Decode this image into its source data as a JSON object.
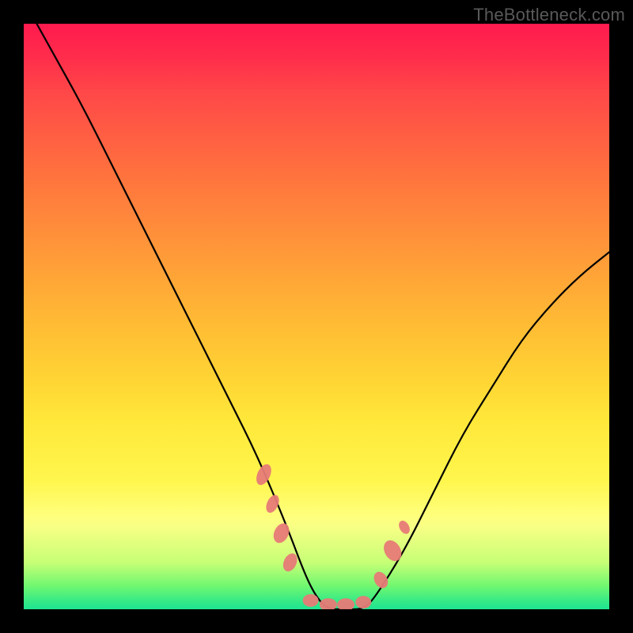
{
  "watermark": "TheBottleneck.com",
  "colors": {
    "background": "#000000",
    "curve_stroke": "#000000",
    "marker_fill": "#e77b77",
    "watermark_text": "#595959"
  },
  "chart_data": {
    "type": "line",
    "title": "",
    "xlabel": "",
    "ylabel": "",
    "xlim": [
      0,
      100
    ],
    "ylim": [
      0,
      100
    ],
    "grid": false,
    "series": [
      {
        "name": "bottleneck-curve",
        "x": [
          0,
          5,
          10,
          15,
          20,
          25,
          30,
          35,
          40,
          45,
          48,
          50,
          52,
          55,
          58,
          60,
          65,
          70,
          75,
          80,
          85,
          90,
          95,
          100
        ],
        "y": [
          104,
          95,
          86,
          76,
          66,
          56,
          46,
          36,
          26,
          14,
          6,
          2,
          0,
          0,
          0,
          2,
          10,
          20,
          30,
          38,
          46,
          52,
          57,
          61
        ]
      }
    ],
    "markers": {
      "name": "highlighted-points",
      "shape": "blob",
      "color": "#e77b77",
      "clusters": [
        {
          "x_range": [
            40,
            44
          ],
          "y_range": [
            14,
            26
          ]
        },
        {
          "x_range": [
            48,
            60
          ],
          "y_range": [
            0,
            3
          ]
        },
        {
          "x_range": [
            61,
            65
          ],
          "y_range": [
            7,
            14
          ]
        }
      ]
    }
  }
}
